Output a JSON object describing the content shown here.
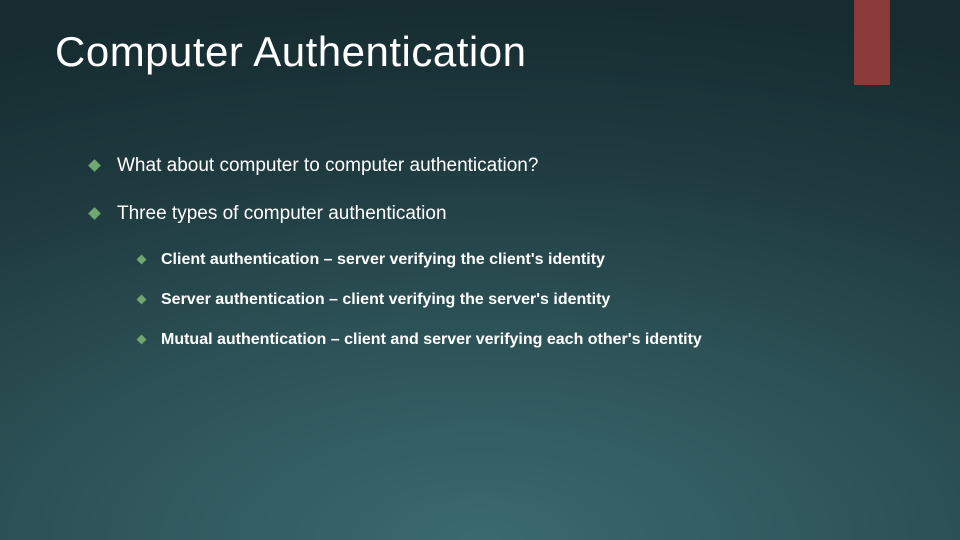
{
  "title": "Computer Authentication",
  "bullets": {
    "b1": "What about computer to computer authentication?",
    "b2": "Three types of computer authentication",
    "sub1": "Client authentication – server verifying the client's identity",
    "sub2": "Server authentication – client verifying the server's identity",
    "sub3": "Mutual authentication – client and server verifying each other's identity"
  }
}
